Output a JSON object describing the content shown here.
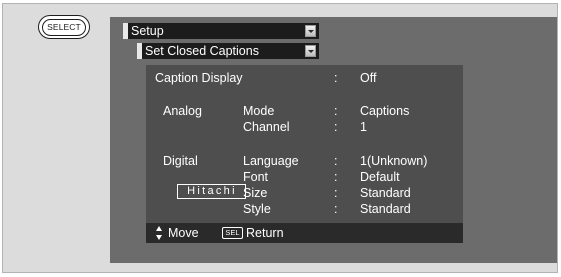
{
  "remote": {
    "select_button_label": "SELECT"
  },
  "menu": {
    "title": "Setup",
    "submenu_title": "Set Closed Captions"
  },
  "settings": {
    "caption_display": {
      "label": "Caption Display",
      "separator": ":",
      "value": "Off"
    },
    "analog": {
      "label": "Analog",
      "rows": [
        {
          "name": "Mode",
          "separator": ":",
          "value": "Captions"
        },
        {
          "name": "Channel",
          "separator": ":",
          "value": "1"
        }
      ]
    },
    "digital": {
      "label": "Digital",
      "rows": [
        {
          "name": "Language",
          "separator": ":",
          "value": "1(Unknown)"
        },
        {
          "name": "Font",
          "separator": ":",
          "value": "Default"
        },
        {
          "name": "Size",
          "separator": ":",
          "value": "Standard"
        },
        {
          "name": "Style",
          "separator": ":",
          "value": "Standard"
        }
      ]
    }
  },
  "brand_logo_text": "Hitachi",
  "footer": {
    "move_label": "Move",
    "sel_key_label": "SEL",
    "return_label": "Return"
  }
}
